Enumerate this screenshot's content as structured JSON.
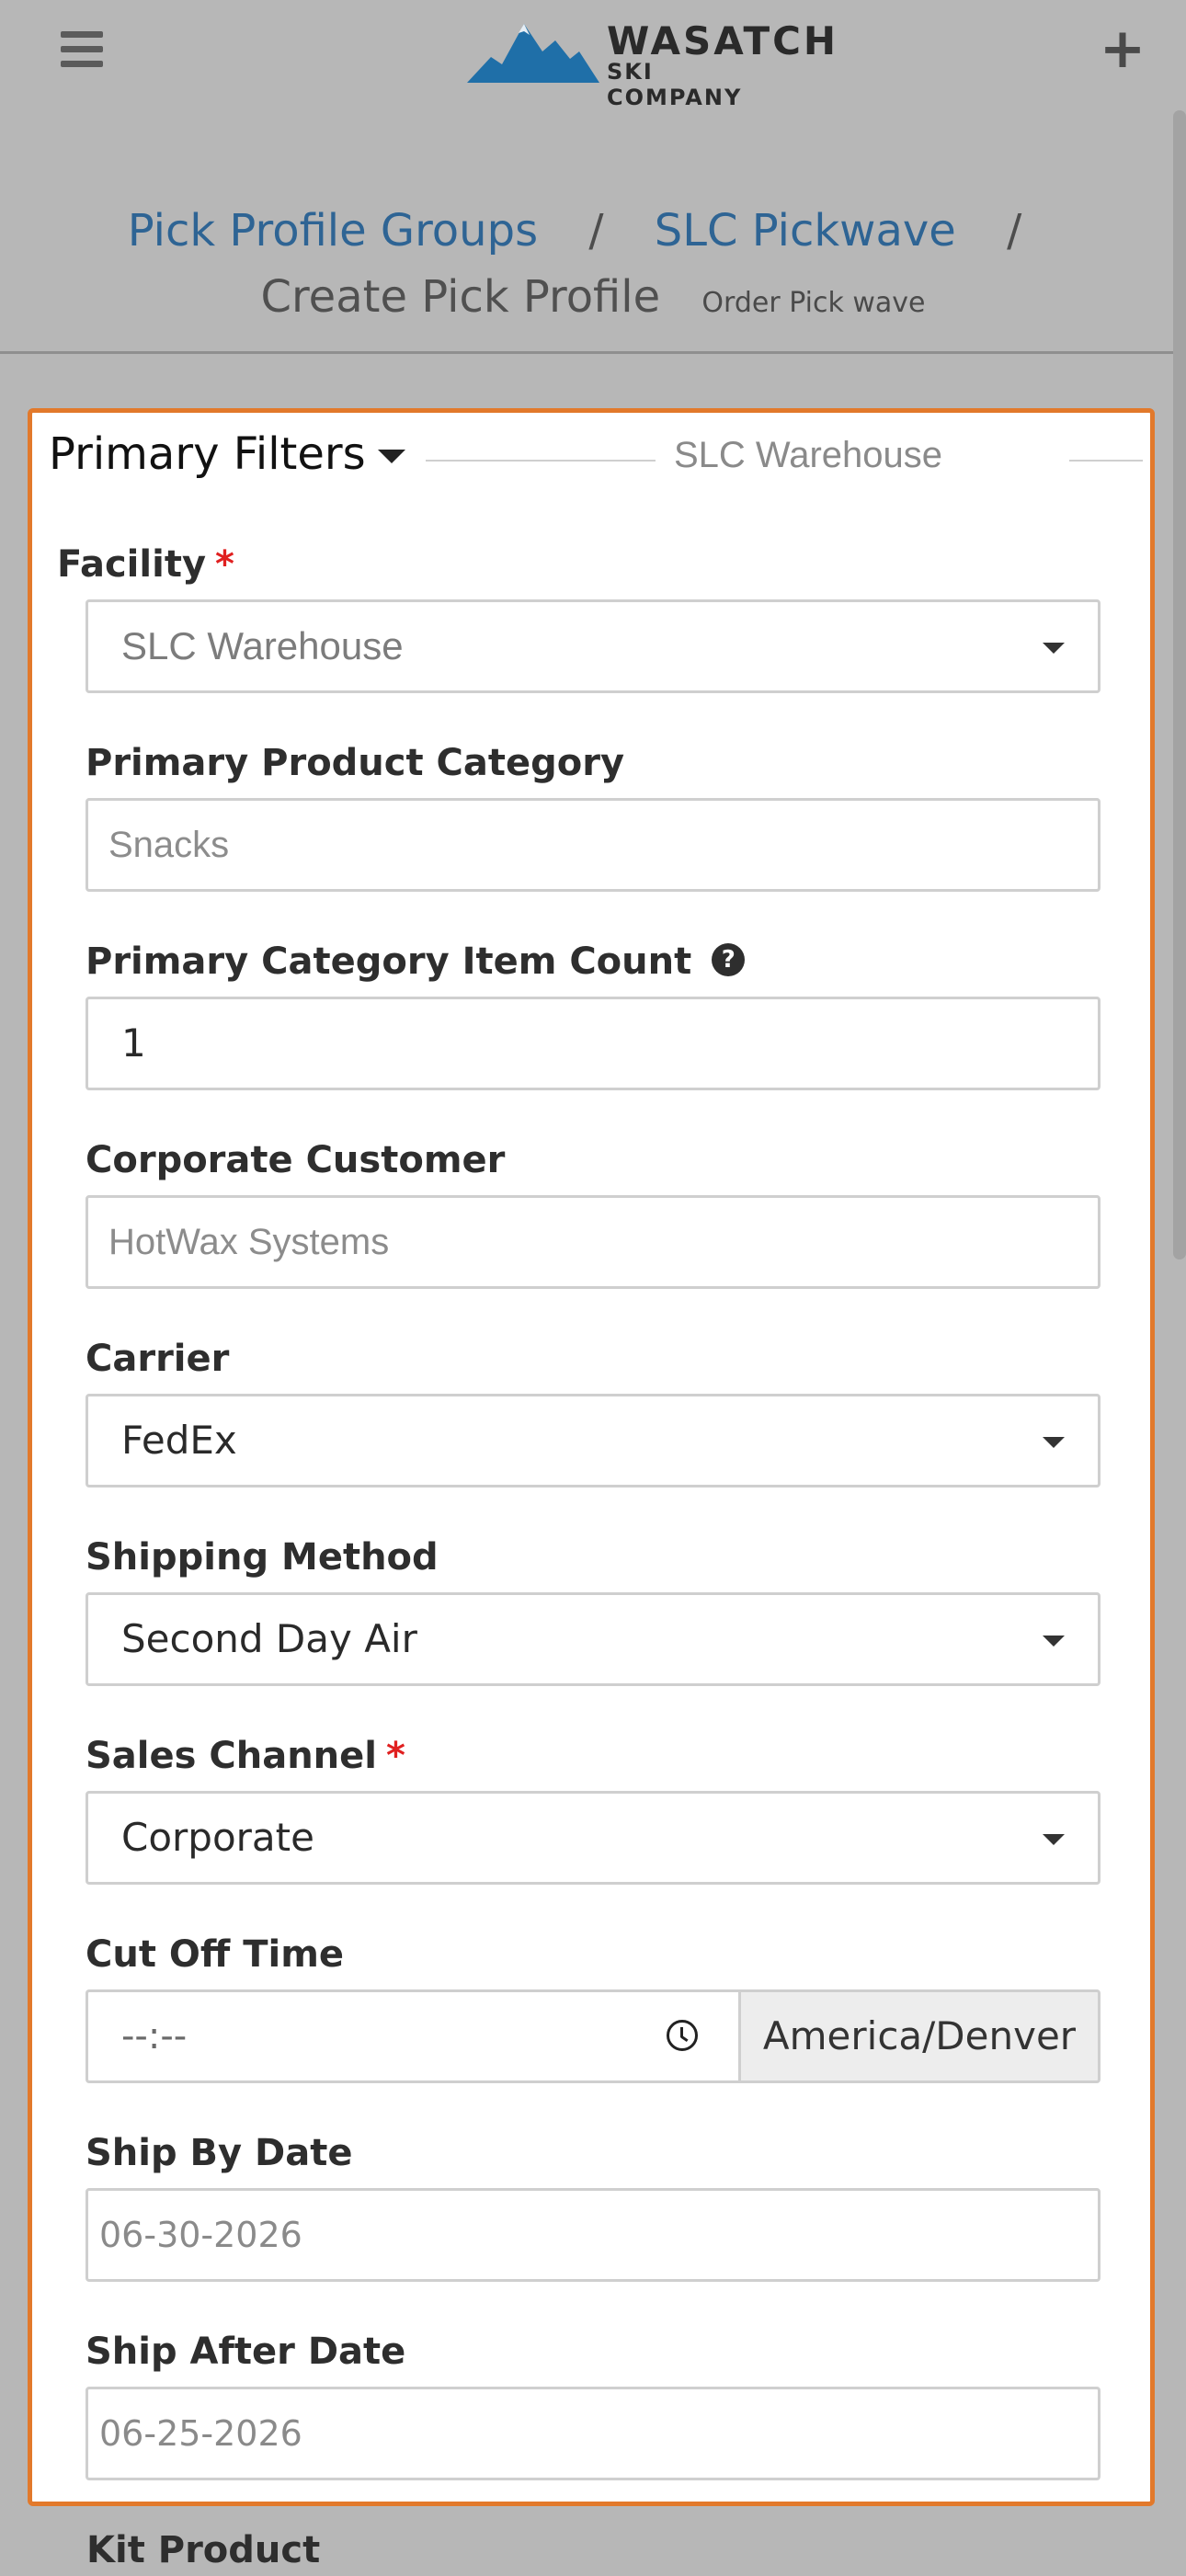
{
  "header": {
    "brand_line1": "WASATCH",
    "brand_line2": "SKI COMPANY",
    "accent_color": "#1f6fa8"
  },
  "breadcrumb": {
    "group": "Pick Profile Groups",
    "separator": "/",
    "wave": "SLC Pickwave",
    "current": "Create Pick Profile",
    "subtitle": "Order Pick wave"
  },
  "panel": {
    "title": "Primary Filters",
    "facility_tag": "SLC Warehouse",
    "border_color": "#e2792b"
  },
  "fields": {
    "facility": {
      "label": "Facility",
      "required": "*",
      "value": "SLC Warehouse"
    },
    "product_category": {
      "label": "Primary Product Category",
      "placeholder": "Snacks"
    },
    "item_count": {
      "label": "Primary Category Item Count",
      "value": "1",
      "help_icon": "?"
    },
    "corporate_customer": {
      "label": "Corporate Customer",
      "placeholder": "HotWax Systems"
    },
    "carrier": {
      "label": "Carrier",
      "value": "FedEx"
    },
    "shipping_method": {
      "label": "Shipping Method",
      "value": "Second Day Air"
    },
    "sales_channel": {
      "label": "Sales Channel",
      "required": "*",
      "value": "Corporate"
    },
    "cut_off_time": {
      "label": "Cut Off Time",
      "value": "--:--",
      "timezone": "America/Denver"
    },
    "ship_by_date": {
      "label": "Ship By Date",
      "value": "06-30-2026"
    },
    "ship_after_date": {
      "label": "Ship After Date",
      "value": "06-25-2026"
    }
  },
  "below_panel": {
    "kit_product_label": "Kit Product"
  }
}
